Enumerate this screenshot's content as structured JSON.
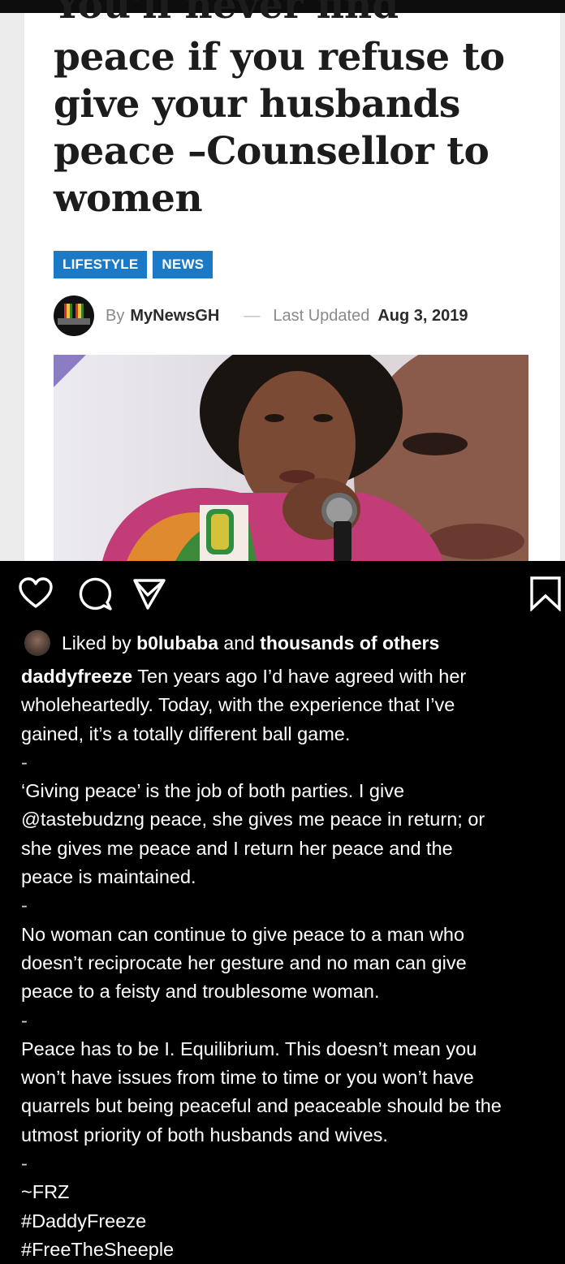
{
  "article": {
    "headline_cut": "You'll never find",
    "headline_lines": [
      "peace if you refuse to",
      "give your husbands",
      "peace –Counsellor to",
      "women"
    ],
    "tags": [
      "LIFESTYLE",
      "NEWS"
    ],
    "byline": {
      "by": "By",
      "author": "MyNewsGH",
      "dash": "—",
      "updated_label": "Last Updated",
      "date": "Aug 3, 2019"
    }
  },
  "instagram": {
    "icons": {
      "like": "heart-icon",
      "comment": "comment-icon",
      "share": "paper-plane-icon",
      "save": "bookmark-icon"
    },
    "liked": {
      "prefix": "Liked by",
      "user": "b0lubaba",
      "middle": "and",
      "others": "thousands of others"
    },
    "caption": {
      "username": "daddyfreeze",
      "line1_rest": " Ten years ago I’d have agreed with her",
      "lines": [
        "wholeheartedly. Today, with the experience that I’ve",
        "gained, it’s a totally different ball game.",
        "-",
        "‘Giving peace’ is the job of both parties. I give",
        "@tastebudzng peace, she gives me peace in return; or",
        "she gives me peace and I return her peace and the",
        "peace is maintained.",
        "-",
        "No woman can continue to give peace to a man who",
        "doesn’t reciprocate her gesture and no man can give",
        "peace to a feisty and troublesome woman.",
        "-",
        "Peace has to be I. Equilibrium. This doesn’t mean you",
        "won’t have issues from time to time or you won’t have",
        "quarrels but being peaceful and peaceable should be the",
        "utmost priority of both husbands and wives.",
        "-",
        "~FRZ",
        "#DaddyFreeze",
        "#FreeTheSheeple"
      ]
    }
  },
  "colors": {
    "tag_blue": "#1a7ac8",
    "ig_background": "#000000",
    "headline_text": "#1c1c1c"
  }
}
